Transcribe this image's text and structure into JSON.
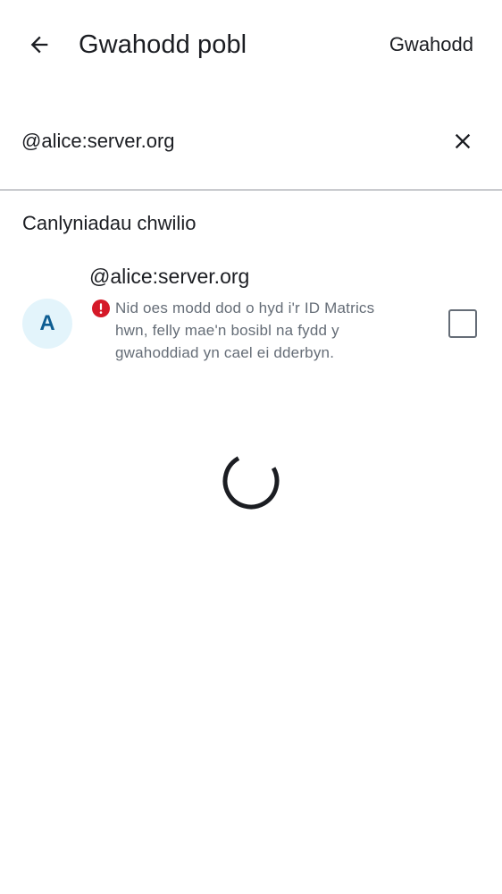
{
  "header": {
    "back_icon": "arrow-left-icon",
    "title": "Gwahodd pobl",
    "action_label": "Gwahodd"
  },
  "search": {
    "value": "@alice:server.org",
    "clear_icon": "close-icon"
  },
  "results": {
    "heading": "Canlyniadau chwilio",
    "items": [
      {
        "avatar_letter": "A",
        "name": "@alice:server.org",
        "warning_icon": "error-icon",
        "warning": "Nid oes modd dod o hyd i'r ID Matrics hwn, felly mae'n bosibl na fydd y gwahoddiad yn cael ei dderbyn.",
        "checked": false
      }
    ]
  },
  "loading": {
    "icon": "loading-spinner-icon"
  },
  "colors": {
    "text_primary": "#1b1d22",
    "text_secondary": "#656d77",
    "avatar_bg": "#e3f4fb",
    "avatar_text": "#0d5d92",
    "error": "#d51928",
    "divider": "#8d9199"
  }
}
